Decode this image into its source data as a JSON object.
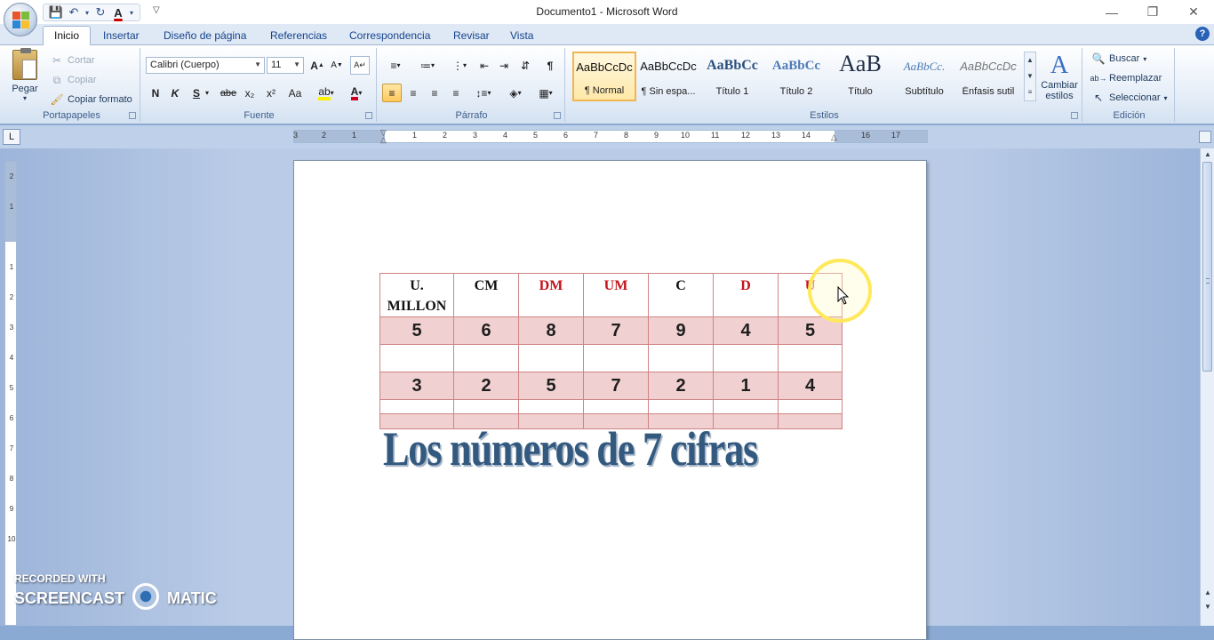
{
  "window": {
    "title": "Documento1 - Microsoft Word",
    "minimize_icon": "minimize-icon",
    "maximize_icon": "restore-icon",
    "close_icon": "close-icon"
  },
  "ribbon_tabs": [
    "Inicio",
    "Insertar",
    "Diseño de página",
    "Referencias",
    "Correspondencia",
    "Revisar",
    "Vista"
  ],
  "ribbon": {
    "clipboard": {
      "label": "Portapapeles",
      "paste": "Pegar",
      "cut": "Cortar",
      "copy": "Copiar",
      "format_painter": "Copiar formato"
    },
    "font": {
      "label": "Fuente",
      "font_name": "Calibri (Cuerpo)",
      "font_size": "11",
      "bold": "N",
      "italic": "K",
      "underline": "S",
      "strike": "abe",
      "subscript": "x₂",
      "superscript": "x²",
      "change_case": "Aa"
    },
    "paragraph": {
      "label": "Párrafo"
    },
    "styles": {
      "label": "Estilos",
      "items": [
        {
          "sample": "AaBbCcDc",
          "name": "¶ Normal"
        },
        {
          "sample": "AaBbCcDc",
          "name": "¶ Sin espa..."
        },
        {
          "sample": "AaBbCc",
          "name": "Título 1"
        },
        {
          "sample": "AaBbCc",
          "name": "Título 2"
        },
        {
          "sample": "AaB",
          "name": "Título"
        },
        {
          "sample": "AaBbCc.",
          "name": "Subtítulo"
        },
        {
          "sample": "AaBbCcDc",
          "name": "Énfasis sutil"
        }
      ],
      "change_styles": "Cambiar estilos"
    },
    "editing": {
      "label": "Edición",
      "find": "Buscar",
      "replace": "Reemplazar",
      "select": "Seleccionar"
    }
  },
  "ruler": {
    "horizontal": [
      "3",
      "2",
      "1",
      "1",
      "2",
      "3",
      "4",
      "5",
      "6",
      "7",
      "8",
      "9",
      "10",
      "11",
      "12",
      "13",
      "14",
      "15",
      "16",
      "17"
    ],
    "vertical": [
      "2",
      "1",
      "1",
      "2",
      "3",
      "4",
      "5",
      "6",
      "7",
      "8",
      "9",
      "10"
    ]
  },
  "document": {
    "table": {
      "headers": [
        {
          "text": "U. MILLON",
          "color": "#111111"
        },
        {
          "text": "CM",
          "color": "#111111"
        },
        {
          "text": "DM",
          "color": "#c4131b"
        },
        {
          "text": "UM",
          "color": "#c4131b"
        },
        {
          "text": "C",
          "color": "#111111"
        },
        {
          "text": "D",
          "color": "#c4131b"
        },
        {
          "text": "U",
          "color": "#c4131b"
        }
      ],
      "row1": [
        "5",
        "6",
        "8",
        "7",
        "9",
        "4",
        "5"
      ],
      "row2": [
        "3",
        "2",
        "5",
        "7",
        "2",
        "1",
        "4"
      ]
    },
    "wordart": "Los números de 7 cifras"
  },
  "watermark": {
    "line1": "RECORDED WITH",
    "line2a": "SCREENCAST",
    "line2b": "MATIC"
  }
}
